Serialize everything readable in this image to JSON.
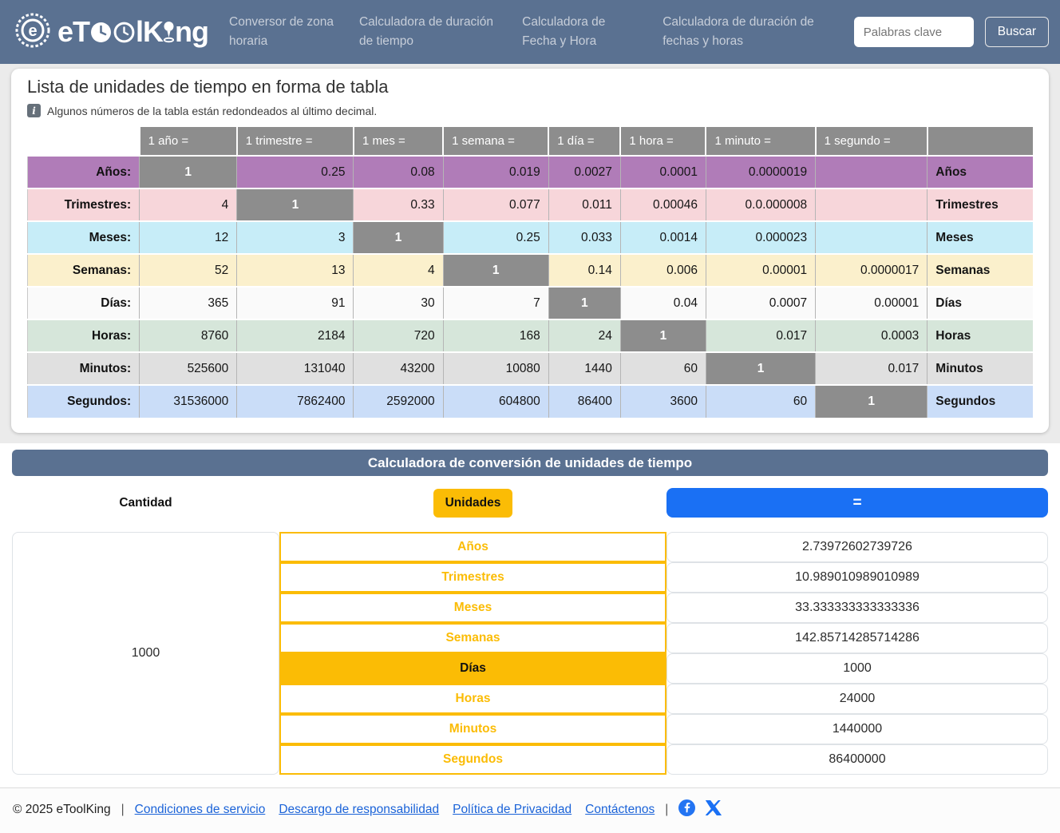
{
  "header": {
    "brand": "eToolKing",
    "nav": [
      {
        "label": "Conversor de zona horaria"
      },
      {
        "label": "Calculadora de duración de tiempo"
      },
      {
        "label": "Calculadora de Fecha y Hora"
      },
      {
        "label": "Calculadora de duración de fechas y horas"
      }
    ],
    "search_placeholder": "Palabras clave",
    "search_button": "Buscar"
  },
  "table_section": {
    "title": "Lista de unidades de tiempo en forma de tabla",
    "info_icon": "i",
    "note": "Algunos números de la tabla están redondeados al último decimal.",
    "col_headers": [
      "",
      "1 año =",
      "1 trimestre =",
      "1 mes =",
      "1 semana =",
      "1 día =",
      "1 hora =",
      "1 minuto =",
      "1 segundo =",
      ""
    ],
    "rows": [
      {
        "label": "Años:",
        "end_label": "Años",
        "color": "#b07cb8",
        "cells": [
          "1",
          "0.25",
          "0.08",
          "0.019",
          "0.0027",
          "0.0001",
          "0.0000019",
          ""
        ]
      },
      {
        "label": "Trimestres:",
        "end_label": "Trimestres",
        "color": "#f7d6da",
        "cells": [
          "4",
          "1",
          "0.33",
          "0.077",
          "0.011",
          "0.00046",
          "0.0.000008",
          ""
        ]
      },
      {
        "label": "Meses:",
        "end_label": "Meses",
        "color": "#c7edf8",
        "cells": [
          "12",
          "3",
          "1",
          "0.25",
          "0.033",
          "0.0014",
          "0.000023",
          ""
        ]
      },
      {
        "label": "Semanas:",
        "end_label": "Semanas",
        "color": "#fbf0cc",
        "cells": [
          "52",
          "13",
          "4",
          "1",
          "0.14",
          "0.006",
          "0.00001",
          "0.0000017"
        ]
      },
      {
        "label": "Días:",
        "end_label": "Días",
        "color": "#fafafa",
        "cells": [
          "365",
          "91",
          "30",
          "7",
          "1",
          "0.04",
          "0.0007",
          "0.00001"
        ]
      },
      {
        "label": "Horas:",
        "end_label": "Horas",
        "color": "#d6e6da",
        "cells": [
          "8760",
          "2184",
          "720",
          "168",
          "24",
          "1",
          "0.017",
          "0.0003"
        ]
      },
      {
        "label": "Minutos:",
        "end_label": "Minutos",
        "color": "#e0e0e0",
        "cells": [
          "525600",
          "131040",
          "43200",
          "10080",
          "1440",
          "60",
          "1",
          "0.017"
        ]
      },
      {
        "label": "Segundos:",
        "end_label": "Segundos",
        "color": "#caddf8",
        "cells": [
          "31536000",
          "7862400",
          "2592000",
          "604800",
          "86400",
          "3600",
          "60",
          "1"
        ]
      }
    ]
  },
  "calculator": {
    "title": "Calculadora de conversión de unidades de tiempo",
    "amount_label": "Cantidad",
    "units_label": "Unidades",
    "equals_label": "=",
    "amount_value": "1000",
    "units": [
      {
        "label": "Años",
        "result": "2.73972602739726",
        "selected": false
      },
      {
        "label": "Trimestres",
        "result": "10.989010989010989",
        "selected": false
      },
      {
        "label": "Meses",
        "result": "33.333333333333336",
        "selected": false
      },
      {
        "label": "Semanas",
        "result": "142.85714285714286",
        "selected": false
      },
      {
        "label": "Días",
        "result": "1000",
        "selected": true
      },
      {
        "label": "Horas",
        "result": "24000",
        "selected": false
      },
      {
        "label": "Minutos",
        "result": "1440000",
        "selected": false
      },
      {
        "label": "Segundos",
        "result": "86400000",
        "selected": false
      }
    ]
  },
  "footer": {
    "copyright": "© 2025 eToolKing",
    "separator": "|",
    "links": [
      "Condiciones de servicio",
      "Descargo de responsabilidad",
      "Política de Privacidad",
      "Contáctenos"
    ],
    "social": [
      "facebook-icon",
      "x-twitter-icon"
    ]
  },
  "colors": {
    "header_bg": "#5a7191",
    "nav_text": "#c7ced9",
    "page_gray": "#ebebeb",
    "table_header_gray": "#8d8d8d",
    "accent_yellow": "#fbbc05",
    "accent_blue": "#1a70f4",
    "link_blue": "#1b63d8"
  }
}
